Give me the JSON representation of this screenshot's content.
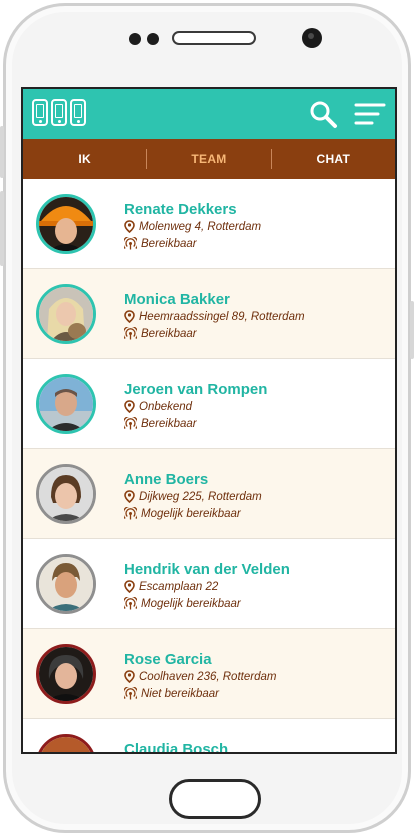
{
  "tabs": [
    {
      "label": "IK"
    },
    {
      "label": "TEAM"
    },
    {
      "label": "CHAT"
    }
  ],
  "active_tab": "TEAM",
  "icons": {
    "logo": "phones-logo-icon",
    "search": "search-icon",
    "menu": "menu-icon",
    "location": "location-pin-icon",
    "availability": "signal-icon"
  },
  "colors": {
    "accent": "#2ec4b0",
    "tabbar": "#8a3f10",
    "active_tab": "#f7b777",
    "name": "#21b5a3",
    "detail": "#6e2f0c"
  },
  "contacts": [
    {
      "name": "Renate Dekkers",
      "location": "Molenweg 4, Rotterdam",
      "status": "Bereikbaar"
    },
    {
      "name": "Monica Bakker",
      "location": "Heemraadssingel 89, Rotterdam",
      "status": "Bereikbaar"
    },
    {
      "name": "Jeroen van Rompen",
      "location": "Onbekend",
      "status": "Bereikbaar"
    },
    {
      "name": "Anne Boers",
      "location": "Dijkweg 225, Rotterdam",
      "status": "Mogelijk bereikbaar"
    },
    {
      "name": "Hendrik van der Velden",
      "location": "Escamplaan 22",
      "status": "Mogelijk bereikbaar"
    },
    {
      "name": "Rose Garcia",
      "location": "Coolhaven 236, Rotterdam",
      "status": "Niet bereikbaar"
    },
    {
      "name": "Claudia Bosch",
      "location": "",
      "status": ""
    }
  ]
}
